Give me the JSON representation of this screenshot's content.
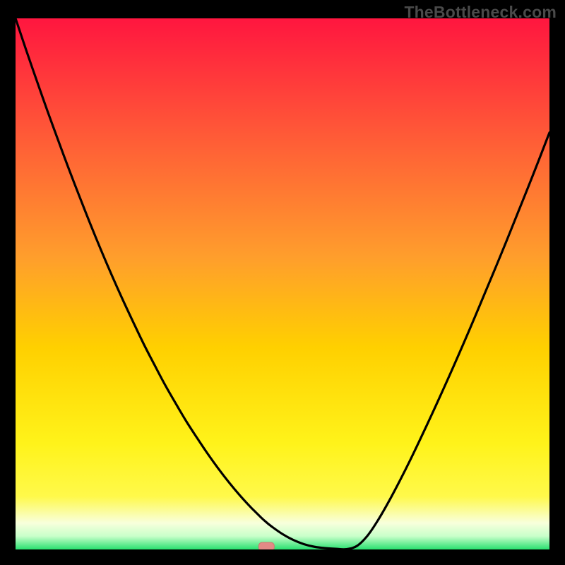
{
  "watermark": "TheBottleneck.com",
  "colors": {
    "frame": "#000000",
    "gradient_top": "#ff163f",
    "gradient_mid_upper": "#ff6b34",
    "gradient_mid": "#ffd000",
    "gradient_lower": "#fff94a",
    "gradient_bottom_pale": "#f8ffdc",
    "gradient_green": "#28e070",
    "curve": "#000000",
    "marker_fill": "#e28a86",
    "marker_stroke": "#d07670"
  },
  "chart_data": {
    "type": "line",
    "title": "",
    "xlabel": "",
    "ylabel": "",
    "xlim": [
      0,
      100
    ],
    "ylim": [
      0,
      100
    ],
    "x": [
      0,
      2,
      4,
      6,
      8,
      10,
      12,
      14,
      16,
      18,
      20,
      22,
      24,
      26,
      28,
      30,
      32,
      34,
      36,
      38,
      40,
      42,
      44,
      45,
      46,
      47,
      48,
      50,
      52,
      54,
      56,
      58,
      60,
      62,
      64,
      66,
      68,
      70,
      72,
      74,
      76,
      78,
      80,
      82,
      84,
      86,
      88,
      90,
      92,
      94,
      96,
      98,
      100
    ],
    "values": [
      100,
      94,
      88.2,
      82.5,
      77,
      71.6,
      66.4,
      61.3,
      56.4,
      51.7,
      47.2,
      42.9,
      38.7,
      34.8,
      31,
      27.5,
      24.1,
      21,
      18,
      15.2,
      12.6,
      10.2,
      8,
      7,
      6,
      5.1,
      4.3,
      2.9,
      1.8,
      1,
      0.5,
      0.25,
      0.12,
      0.06,
      0.7,
      2.7,
      5.7,
      9.2,
      13,
      17,
      21.2,
      25.5,
      29.9,
      34.4,
      39,
      43.7,
      48.5,
      53.3,
      58.2,
      63.2,
      68.2,
      73.3,
      78.5
    ],
    "minimum_marker": {
      "x": 47,
      "y": 0
    },
    "grid": false,
    "legend": false,
    "axes_visible": false
  }
}
